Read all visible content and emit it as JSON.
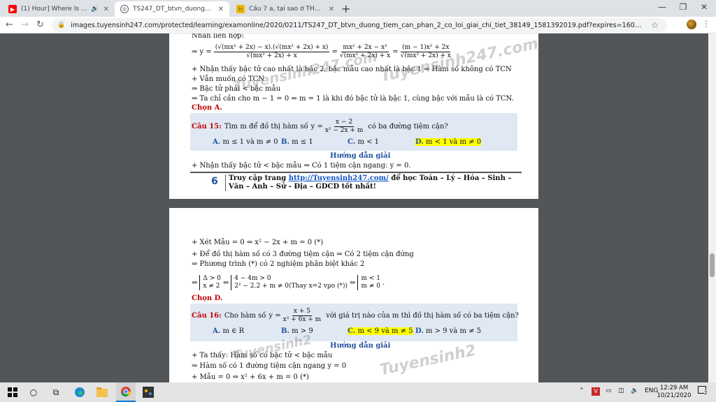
{
  "browser": {
    "tabs": [
      {
        "label": "(1) Hour] Where Is Your Love",
        "favicon_color": "#ff0000",
        "icon": "youtube-icon"
      },
      {
        "label": "TS247_DT_btvn_duong_tiem_can_",
        "favicon_color": "#3c4043",
        "icon": "globe-icon"
      },
      {
        "label": "Câu 7 a, tại sao ở TH1 không xét",
        "favicon_color": "#f4b400",
        "icon": "hoidap-icon"
      }
    ],
    "url": "images.tuyensinh247.com/protected/learning/examonline/2020/0211/TS247_DT_btvn_duong_tiem_can_phan_2_co_loi_giai_chi_tiet_38149_1581392019.pdf?expires=1603212154&md5=5mZIOSzXVeSLP..."
  },
  "doc": {
    "top_cut": "Nhân liên hợp:",
    "eq1_lhs": "⇒ y =",
    "eq1_num": "(√(mx² + 2x) − x).(√(mx² + 2x) + x)",
    "eq1_den": "√(mx² + 2x) + x",
    "eq1_mid_num": "mx² + 2x − x²",
    "eq1_mid_den": "√(mx² + 2x) + x",
    "eq1_r_num": "(m − 1)x² + 2x",
    "eq1_r_den": "√(mx² + 2x) + x",
    "p1": "+ Nhận thấy bậc tử cao nhất là bậc 2, bậc mẫu cao nhất là bậc 1 ⇒ Hàm số không có TCN",
    "p2": "+ Vẫn muốn có TCN",
    "p3": "⇒ Bậc tử phải < bậc mẫu",
    "p4": "⇒ Ta chỉ cần cho m − 1 = 0 ⇔ m = 1 là khi đó bậc tử là bậc 1, cùng bậc với mẫu là có TCN.",
    "chon_a": "Chọn A.",
    "q15_label": "Câu 15:",
    "q15_text": "Tìm m để đồ thị hàm số",
    "q15_y": "y =",
    "q15_num": "x − 2",
    "q15_den": "x² − 2x + m",
    "q15_tail": "có ba đường tiệm cận?",
    "q15_opts": [
      {
        "key": "A.",
        "text": "m ≤ 1 và m ≠ 0"
      },
      {
        "key": "B.",
        "text": "m ≤ 1"
      },
      {
        "key": "C.",
        "text": "m < 1"
      },
      {
        "key": "D.",
        "text": "m < 1 và m ≠ 0"
      }
    ],
    "huong_dan": "Hướng dẫn giải",
    "q15_sol": "+ Nhận thấy bậc tử < bậc mẫu ⇒ Có 1 tiệm cận ngang: y = 0.",
    "page_number": "6",
    "footer_pre": "Truy cập trang",
    "footer_link": "http://Tuyensinh247.com/",
    "footer_post": "để học Toán – Lý – Hóa – Sinh – Văn – Anh – Sử - Địa – GDCD tốt nhất!",
    "p2_l1": "+ Xét Mẫu = 0 ⇔ x² − 2x + m = 0 (*)",
    "p2_l2": "+ Để đồ thị hàm số có 3 đường tiệm cận ⇒ Có 2 tiệm cận đứng",
    "p2_l3": "⇒ Phương trình (*) có 2 nghiệm phân biệt khác 2",
    "sys_pre": "⇔",
    "sys1": [
      "Δ > 0",
      "x ≠ 2"
    ],
    "sys_mid1": "⇔",
    "sys2": [
      "4 − 4m > 0",
      "2² − 2.2 + m ≠ 0(Thay x=2 vµo (*))"
    ],
    "sys_mid2": "⇔",
    "sys3": [
      "m < 1",
      "m ≠ 0"
    ],
    "sys_end": ".",
    "chon_d": "Chọn D.",
    "q16_label": "Câu 16:",
    "q16_text": "Cho hàm số",
    "q16_y": "y =",
    "q16_num": "x + 5",
    "q16_den": "x² + 6x + m",
    "q16_tail": "với giá trị nào của m thì đồ thị hàm số có ba tiệm cận?",
    "q16_opts": [
      {
        "key": "A.",
        "text": "m ∈ R"
      },
      {
        "key": "B.",
        "text": "m > 9"
      },
      {
        "key": "C.",
        "text": "m < 9 và m ≠ 5"
      },
      {
        "key": "D.",
        "text": "m > 9 và m ≠ 5"
      }
    ],
    "q16_sol1": "+ Ta thấy: Hàm số có bậc tử < bậc mẫu",
    "q16_sol2": "⇒ Hàm số có 1 đường tiệm cận ngang y = 0",
    "q16_sol3": "+ Mẫu = 0 ⇔ x² + 6x + m = 0 (*)",
    "watermark": "Tuyensinh247.com",
    "watermark_short": "Tuyensinh2"
  },
  "taskbar": {
    "lang": "ENG",
    "time": "12:29 AM",
    "date": "10/21/2020",
    "notif": "2"
  }
}
